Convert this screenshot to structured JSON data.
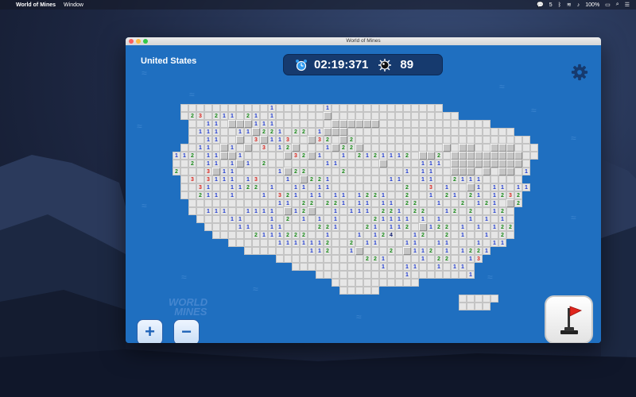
{
  "menubar": {
    "app_name": "World of Mines",
    "menus": [
      "Window"
    ],
    "status_battery": "100%",
    "status_count": "5"
  },
  "window": {
    "title": "World of Mines"
  },
  "game": {
    "region": "United States",
    "timer": "02:19:371",
    "mines_remaining": "89"
  },
  "colors": {
    "board_bg": "#1f6fc0",
    "hud_bg": "#163a6e",
    "number_1": "#1c38d0",
    "number_2": "#1a8a1a",
    "number_3": "#d8241d",
    "flag": "#d8241d"
  },
  "controls": {
    "zoom_in_label": "+",
    "zoom_out_label": "−"
  },
  "icons": {
    "timer": "alarm-clock-icon",
    "mine": "mine-icon",
    "settings": "gear-icon",
    "flag": "flag-icon"
  },
  "map_rows": [
    "...........1......1..............................",
    ".23.211.21.1......c...............................",
    "..11.ccc111.......cccccc...........................",
    ".111..11c221.22.1ccc...........................",
    "..11..c.3c113..c32.c2......................cc.cc.",
    "..11.c1.c.3.12c...1c22c..........c.cc..ccc.....",
    "112.11cc1.....c32c1..1.2121112.cc2.ccccccccc...",
    "..2.11.1c1.2.......11.....c....111.ccccccccc....",
    "2...3c11.....1c22....2.......1.11..ccc.c.cc.1..",
    ".3.3111.13...1.c221.......11..11..2111.......",
    "..31..1122.1..11.11.........2..3.1..c1.11.11.2..",
    "..211.1...1.321.11.11.1221..2..1.21.21.1232.1.",
    "...........11.22.221.11.11.22..1..2.121.c211..",
    "..111..1111.c12c..1.111.221.22..12.2..12.c2...",
    "....11...1.2.1.1.1....21111.1.1...1.1.1.1.....",
    "....11..11....221...21.112.c122.1.1.122..1...",
    ".....2111222..1...1.124..12..2.1..1.2..1.2...",
    "......1111112..2.11...11..11...1.11.1..22.11.",
    "........112..1c...2.c112.1.1221.1...1.1.112...",
    "...........221....1.22..13.21221221111.221.",
    "...........1..11..1.11.1111.....1.1.1...1....",
    "...........1.......1...1....1.11.11.1.1.2..",
    ".........................212.1...........21.",
    ".......................................1...",
    ".........................................11.",
    ".........................................1.."
  ]
}
